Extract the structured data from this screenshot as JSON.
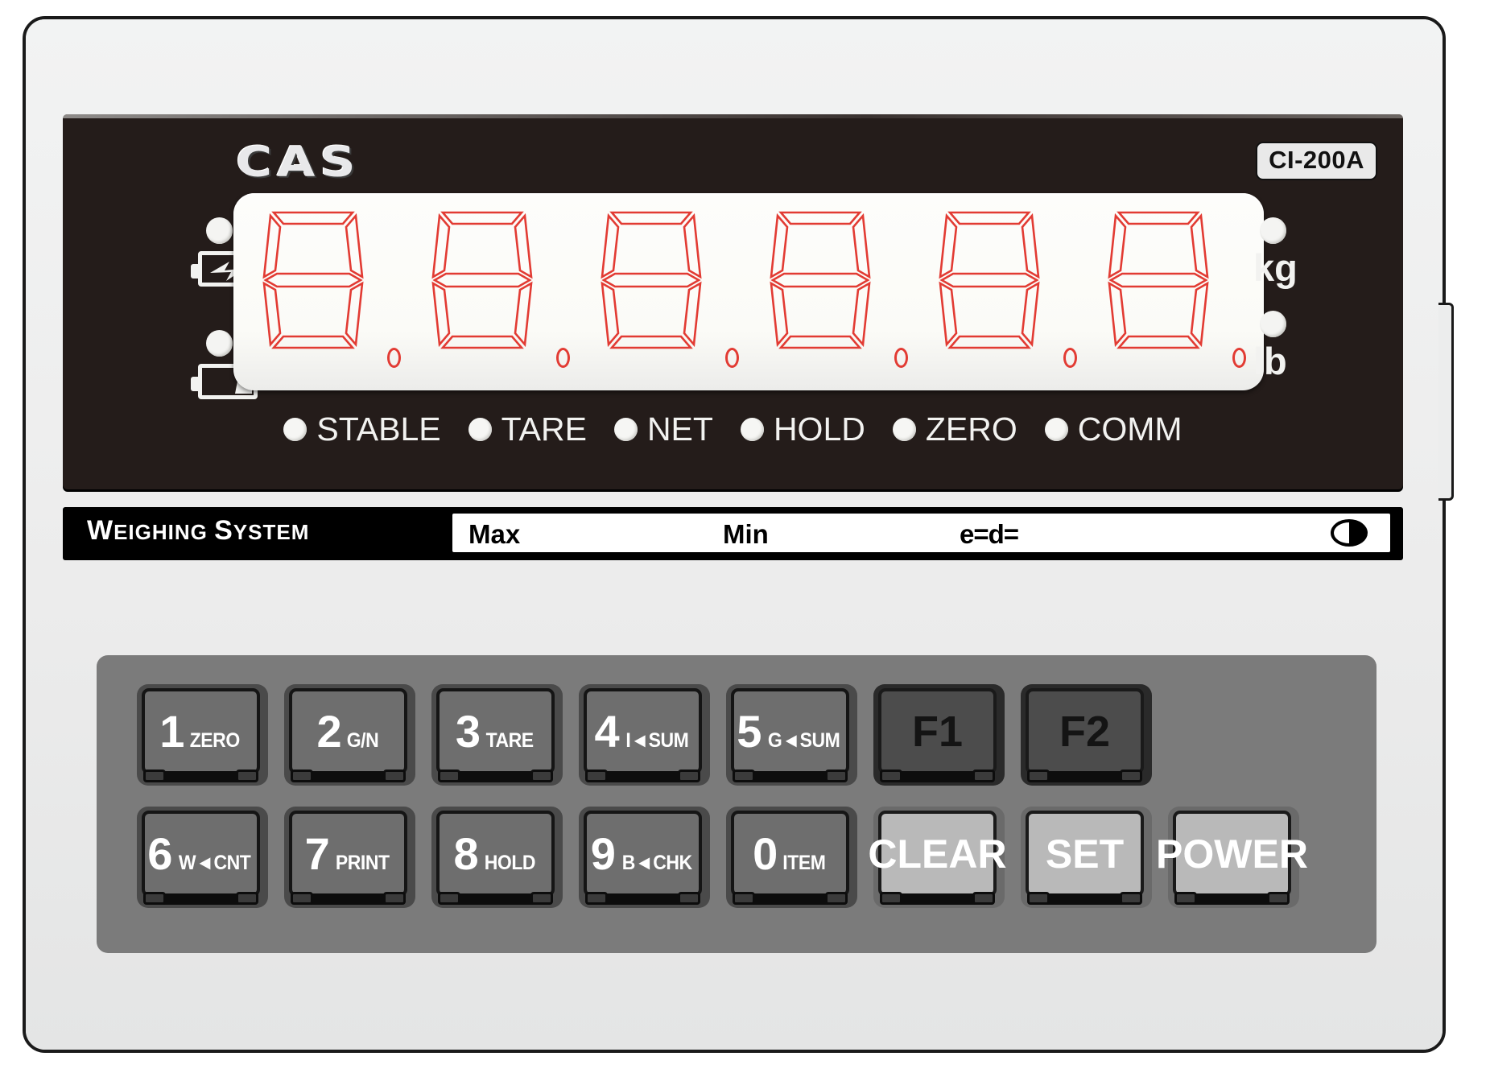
{
  "device": {
    "brand": "CAS",
    "model": "CI-200A",
    "footer_bar": {
      "title_full": "WEIGHING SYSTEM",
      "title_caps": "W",
      "title_rest1": "EIGHING ",
      "title_caps2": "S",
      "title_rest2": "YSTEM",
      "max_label": "Max",
      "min_label": "Min",
      "ed_label": "e=d=",
      "accuracy_class_icon": "oiml-class-icon"
    }
  },
  "display": {
    "digits": [
      "8",
      "8",
      "8",
      "8",
      "8",
      "8"
    ],
    "digit_count": 6,
    "segment_color": "#e23b33",
    "panel_color": "#fbfbf7",
    "decimal_points": 6
  },
  "left_indicators": [
    {
      "id": "charging",
      "icon": "battery-charging-icon",
      "led": "led-off"
    },
    {
      "id": "battery-low",
      "icon": "battery-low-icon",
      "led": "led-off"
    }
  ],
  "unit_indicators": [
    {
      "label": "kg",
      "led": "led-off"
    },
    {
      "label": "lb",
      "led": "led-off"
    }
  ],
  "status_indicators": [
    {
      "label": "STABLE",
      "led": "led-off"
    },
    {
      "label": "TARE",
      "led": "led-off"
    },
    {
      "label": "NET",
      "led": "led-off"
    },
    {
      "label": "HOLD",
      "led": "led-off"
    },
    {
      "label": "ZERO",
      "led": "led-off"
    },
    {
      "label": "COMM",
      "led": "led-off"
    }
  ],
  "keypad": {
    "row1": [
      {
        "name": "key-1-zero",
        "num": "1",
        "sub": "ZERO",
        "style": "num"
      },
      {
        "name": "key-2-gn",
        "num": "2",
        "sub": "G/N",
        "style": "num"
      },
      {
        "name": "key-3-tare",
        "num": "3",
        "sub": "TARE",
        "style": "num"
      },
      {
        "name": "key-4-isum",
        "num": "4",
        "sub": "I◄SUM",
        "style": "num"
      },
      {
        "name": "key-5-gsum",
        "num": "5",
        "sub": "G◄SUM",
        "style": "num"
      },
      {
        "name": "key-f1",
        "num": "",
        "sub": "F1",
        "style": "fn"
      },
      {
        "name": "key-f2",
        "num": "",
        "sub": "F2",
        "style": "fn"
      }
    ],
    "row2": [
      {
        "name": "key-6-wcnt",
        "num": "6",
        "sub": "W◄CNT",
        "style": "num"
      },
      {
        "name": "key-7-print",
        "num": "7",
        "sub": "PRINT",
        "style": "num"
      },
      {
        "name": "key-8-hold",
        "num": "8",
        "sub": "HOLD",
        "style": "num"
      },
      {
        "name": "key-9-bchk",
        "num": "9",
        "sub": "B◄CHK",
        "style": "num"
      },
      {
        "name": "key-0-item",
        "num": "0",
        "sub": "ITEM",
        "style": "num"
      },
      {
        "name": "key-clear",
        "num": "",
        "sub": "CLEAR",
        "style": "lt"
      },
      {
        "name": "key-set",
        "num": "",
        "sub": "SET",
        "style": "lt"
      },
      {
        "name": "key-power",
        "num": "",
        "sub": "POWER",
        "style": "lt"
      }
    ]
  },
  "colors": {
    "segment_red": "#e23b33",
    "bezel_black": "#241c1a",
    "housing_gray": "#eceded",
    "keypad_gray": "#7b7b7b"
  }
}
